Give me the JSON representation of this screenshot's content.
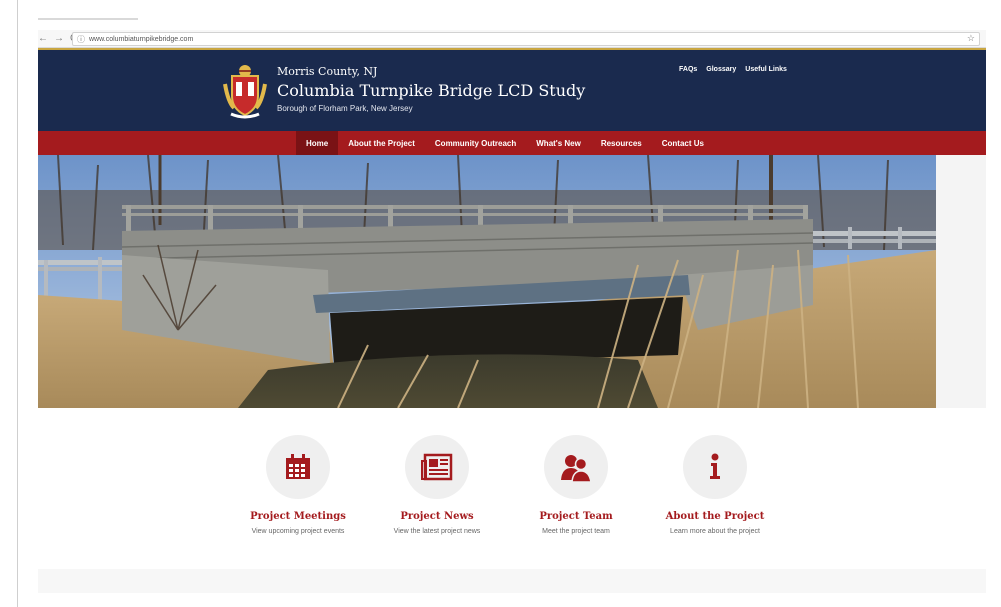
{
  "browser": {
    "back_icon": "back-arrow-icon",
    "forward_icon": "forward-arrow-icon",
    "reload_icon": "reload-icon",
    "url": "www.columbiaturnpikebridge.com",
    "star_icon": "bookmark-star-icon"
  },
  "header": {
    "county": "Morris County, NJ",
    "title": "Columbia Turnpike Bridge LCD Study",
    "subtitle": "Borough of Florham Park, New Jersey",
    "links": [
      "FAQs",
      "Glossary",
      "Useful Links"
    ]
  },
  "menu": {
    "items": [
      "Home",
      "About the Project",
      "Community Outreach",
      "What's New",
      "Resources",
      "Contact Us"
    ],
    "active": "Home"
  },
  "features": [
    {
      "title": "Project Meetings",
      "desc": "View upcoming project events",
      "icon": "calendar-icon"
    },
    {
      "title": "Project News",
      "desc": "View the latest project news",
      "icon": "newspaper-icon"
    },
    {
      "title": "Project Team",
      "desc": "Meet the project team",
      "icon": "team-icon"
    },
    {
      "title": "About the Project",
      "desc": "Learn more about the project",
      "icon": "info-icon"
    }
  ],
  "colors": {
    "header_navy": "#1a2a4e",
    "menu_red": "#a41b1e",
    "menu_active": "#7a1215",
    "accent_gold": "#c9a641"
  }
}
